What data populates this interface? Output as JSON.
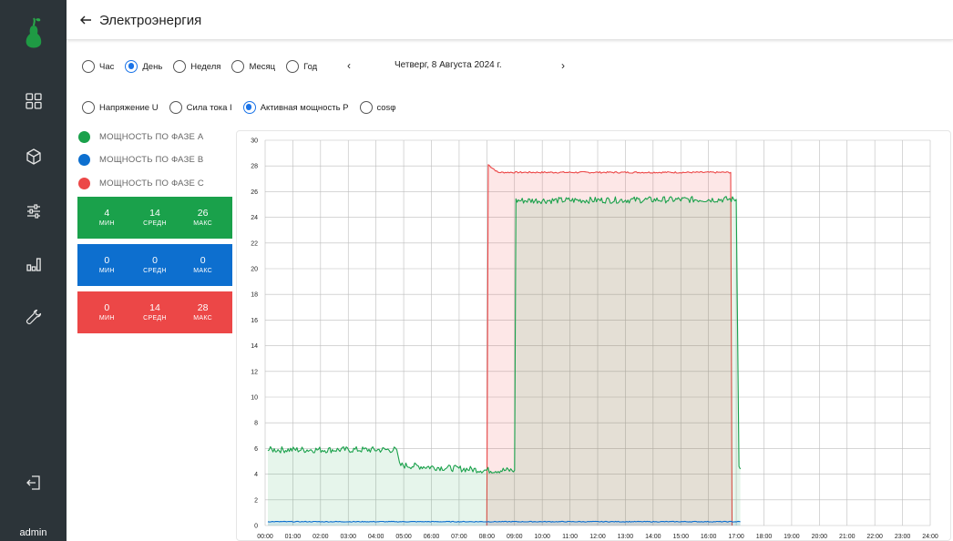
{
  "app": {
    "user": "admin",
    "colors": {
      "sidebar": "#2c3439",
      "accent": "#1a73e8",
      "phase_a": "#1aa14b",
      "phase_b": "#0d6fcf",
      "phase_c": "#ec4747"
    }
  },
  "sidebar": {
    "items": [
      {
        "name": "dashboard-icon"
      },
      {
        "name": "cube-icon"
      },
      {
        "name": "sliders-icon"
      },
      {
        "name": "bar-chart-icon"
      },
      {
        "name": "wrench-icon"
      }
    ],
    "logout": {
      "name": "logout-icon"
    }
  },
  "header": {
    "title": "Электроэнергия"
  },
  "period": {
    "options": [
      {
        "label": "Час",
        "selected": false
      },
      {
        "label": "День",
        "selected": true
      },
      {
        "label": "Неделя",
        "selected": false
      },
      {
        "label": "Месяц",
        "selected": false
      },
      {
        "label": "Год",
        "selected": false
      }
    ],
    "prev": "‹",
    "next": "›",
    "date": "Четверг, 8 Августа 2024 г."
  },
  "metric": {
    "options": [
      {
        "label": "Напряжение U",
        "selected": false
      },
      {
        "label": "Сила тока I",
        "selected": false
      },
      {
        "label": "Активная мощность P",
        "selected": true
      },
      {
        "label": "cosφ",
        "selected": false
      }
    ]
  },
  "legend": [
    {
      "label": "МОЩНОСТЬ ПО ФАЗЕ A",
      "color": "#1aa14b"
    },
    {
      "label": "МОЩНОСТЬ ПО ФАЗЕ B",
      "color": "#0d6fcf"
    },
    {
      "label": "МОЩНОСТЬ ПО ФАЗЕ C",
      "color": "#ec4747"
    }
  ],
  "stats": [
    {
      "color": "#1aa14b",
      "min": "4",
      "avg": "14",
      "max": "26",
      "min_label": "МИН",
      "avg_label": "СРЕДН",
      "max_label": "МАКС"
    },
    {
      "color": "#0d6fcf",
      "min": "0",
      "avg": "0",
      "max": "0",
      "min_label": "МИН",
      "avg_label": "СРЕДН",
      "max_label": "МАКС"
    },
    {
      "color": "#ec4747",
      "min": "0",
      "avg": "14",
      "max": "28",
      "min_label": "МИН",
      "avg_label": "СРЕДН",
      "max_label": "МАКС"
    }
  ],
  "chart_data": {
    "type": "area",
    "x_ticks": [
      "00:00",
      "01:00",
      "02:00",
      "03:00",
      "04:00",
      "05:00",
      "06:00",
      "07:00",
      "08:00",
      "09:00",
      "10:00",
      "11:00",
      "12:00",
      "13:00",
      "14:00",
      "15:00",
      "16:00",
      "17:00",
      "18:00",
      "19:00",
      "20:00",
      "21:00",
      "22:00",
      "23:00",
      "24:00"
    ],
    "y_ticks": [
      0,
      2,
      4,
      6,
      8,
      10,
      12,
      14,
      16,
      18,
      20,
      22,
      24,
      26,
      28,
      30
    ],
    "xlim": [
      0,
      24
    ],
    "ylim": [
      0,
      30
    ],
    "grid": true,
    "series": [
      {
        "name": "МОЩНОСТЬ ПО ФАЗЕ A",
        "color": "#1aa14b",
        "points": [
          [
            0.1,
            5.9
          ],
          [
            4.75,
            5.9
          ],
          [
            4.85,
            4.7
          ],
          [
            8.0,
            4.3
          ],
          [
            9.0,
            4.3
          ],
          [
            9.05,
            25.3
          ],
          [
            17.0,
            25.4
          ],
          [
            17.1,
            4.6
          ],
          [
            17.15,
            4.4
          ]
        ]
      },
      {
        "name": "МОЩНОСТЬ ПО ФАЗЕ B",
        "color": "#0d6fcf",
        "points": [
          [
            0.1,
            0.3
          ],
          [
            17.15,
            0.3
          ]
        ]
      },
      {
        "name": "МОЩНОСТЬ ПО ФАЗЕ C",
        "color": "#ec4747",
        "points": [
          [
            8.0,
            0
          ],
          [
            8.05,
            28.1
          ],
          [
            8.4,
            27.5
          ],
          [
            16.8,
            27.5
          ],
          [
            16.85,
            0
          ]
        ]
      }
    ]
  }
}
